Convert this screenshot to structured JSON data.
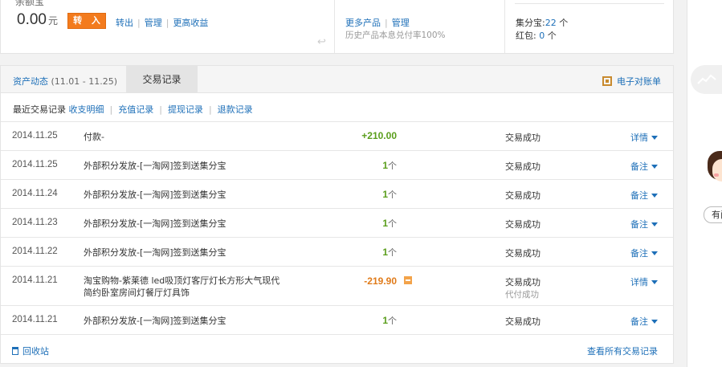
{
  "summary": {
    "cut_title": "余额宝",
    "balance": "0.00",
    "balance_unit": "元",
    "transfer_in": "转 入",
    "links": [
      "转出",
      "管理",
      "更高收益"
    ],
    "more_products": "更多产品",
    "manage": "管理",
    "history_note": "历史产品本息兑付率100%",
    "jifenbao_label": "集分宝:",
    "jifenbao_value": "22",
    "jifenbao_unit": "个",
    "hongbao_label": "红包:",
    "hongbao_value": "0",
    "hongbao_unit": "个"
  },
  "tabs": {
    "assets_label": "资产动态",
    "assets_range": "(11.01 - 11.25)",
    "records_label": "交易记录",
    "ebill_label": "电子对账单"
  },
  "subnav": {
    "current": "最近交易记录",
    "items": [
      "收支明细",
      "充值记录",
      "提现记录",
      "退款记录"
    ]
  },
  "rows": [
    {
      "date": "2014.11.25",
      "desc": "付款-",
      "amount": "+210.00",
      "unit": "",
      "status": "交易成功",
      "status2": "",
      "action": "详情"
    },
    {
      "date": "2014.11.25",
      "desc": "外部积分发放-[一淘网]签到送集分宝",
      "amount": "1",
      "unit": "个",
      "status": "交易成功",
      "status2": "",
      "action": "备注"
    },
    {
      "date": "2014.11.24",
      "desc": "外部积分发放-[一淘网]签到送集分宝",
      "amount": "1",
      "unit": "个",
      "status": "交易成功",
      "status2": "",
      "action": "备注"
    },
    {
      "date": "2014.11.23",
      "desc": "外部积分发放-[一淘网]签到送集分宝",
      "amount": "1",
      "unit": "个",
      "status": "交易成功",
      "status2": "",
      "action": "备注"
    },
    {
      "date": "2014.11.22",
      "desc": "外部积分发放-[一淘网]签到送集分宝",
      "amount": "1",
      "unit": "个",
      "status": "交易成功",
      "status2": "",
      "action": "备注"
    },
    {
      "date": "2014.11.21",
      "desc": "淘宝购物-紫莱德 led吸顶灯客厅灯长方形大气现代简约卧室房间灯餐厅灯具饰",
      "amount": "-219.90",
      "unit": "",
      "status": "交易成功",
      "status2": "代付成功",
      "action": "详情"
    },
    {
      "date": "2014.11.21",
      "desc": "外部积分发放-[一淘网]签到送集分宝",
      "amount": "1",
      "unit": "个",
      "status": "交易成功",
      "status2": "",
      "action": "备注"
    }
  ],
  "footer": {
    "recycle": "回收站",
    "view_all": "查看所有交易记录"
  },
  "rail": {
    "help": "有问题"
  }
}
